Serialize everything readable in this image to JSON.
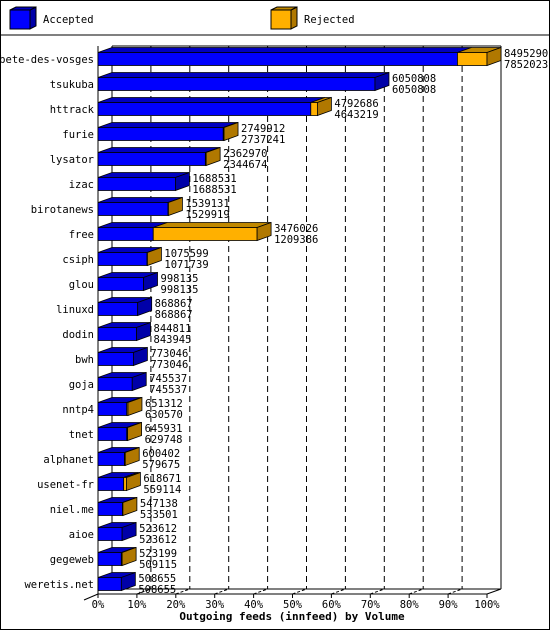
{
  "chart_data": {
    "type": "bar",
    "orientation": "horizontal",
    "stacked": true,
    "style": "3d",
    "title": "",
    "xlabel": "Outgoing feeds (innfeed) by Volume",
    "ylabel": "",
    "xlim": [
      0,
      100
    ],
    "x_unit": "%",
    "x_ticks": [
      "0%",
      "10%",
      "20%",
      "30%",
      "40%",
      "50%",
      "60%",
      "70%",
      "80%",
      "90%",
      "100%"
    ],
    "grid": true,
    "legend": {
      "placement": "top",
      "entries": [
        {
          "name": "Accepted",
          "color": "#0000ff"
        },
        {
          "name": "Rejected",
          "color": "#ffb000"
        }
      ]
    },
    "categories": [
      "bete-des-vosges",
      "tsukuba",
      "httrack",
      "furie",
      "lysator",
      "izac",
      "birotanews",
      "free",
      "csiph",
      "glou",
      "linuxd",
      "dodin",
      "bwh",
      "goja",
      "nntp4",
      "tnet",
      "alphanet",
      "usenet-fr",
      "niel.me",
      "aioe",
      "gegeweb",
      "weretis.net"
    ],
    "totals": [
      8495290,
      6050808,
      4792686,
      2749912,
      2362970,
      1688531,
      1539131,
      3476026,
      1075599,
      998135,
      868867,
      844811,
      773046,
      745537,
      651312,
      645931,
      600402,
      618671,
      547138,
      523612,
      523199,
      508655
    ],
    "accepted_labels": [
      7852023,
      6050808,
      4643219,
      2737241,
      2344674,
      1688531,
      1529919,
      1209386,
      1071739,
      998135,
      868867,
      843945,
      773046,
      745537,
      630570,
      629748,
      579675,
      559114,
      533501,
      523612,
      509115,
      508655
    ],
    "series": [
      {
        "name": "Accepted",
        "unit": "% of max total",
        "values": [
          92.4,
          71.2,
          54.7,
          32.2,
          27.6,
          19.9,
          18.0,
          14.2,
          12.6,
          11.7,
          10.2,
          9.9,
          9.1,
          8.8,
          7.4,
          7.4,
          6.8,
          6.6,
          6.3,
          6.2,
          6.0,
          6.0
        ]
      },
      {
        "name": "Rejected",
        "unit": "% of max total",
        "values": [
          7.6,
          0.0,
          1.7,
          0.2,
          0.2,
          0.0,
          0.1,
          26.7,
          0.1,
          0.0,
          0.0,
          0.0,
          0.0,
          0.0,
          0.3,
          0.2,
          0.2,
          0.7,
          0.1,
          0.0,
          0.2,
          0.0
        ]
      }
    ]
  },
  "colors": {
    "accepted_front": "#0000ff",
    "accepted_side": "#0000a8",
    "accepted_top": "#0000c0",
    "rejected_front": "#ffb000",
    "rejected_side": "#b07800",
    "rejected_top": "#c08800"
  }
}
